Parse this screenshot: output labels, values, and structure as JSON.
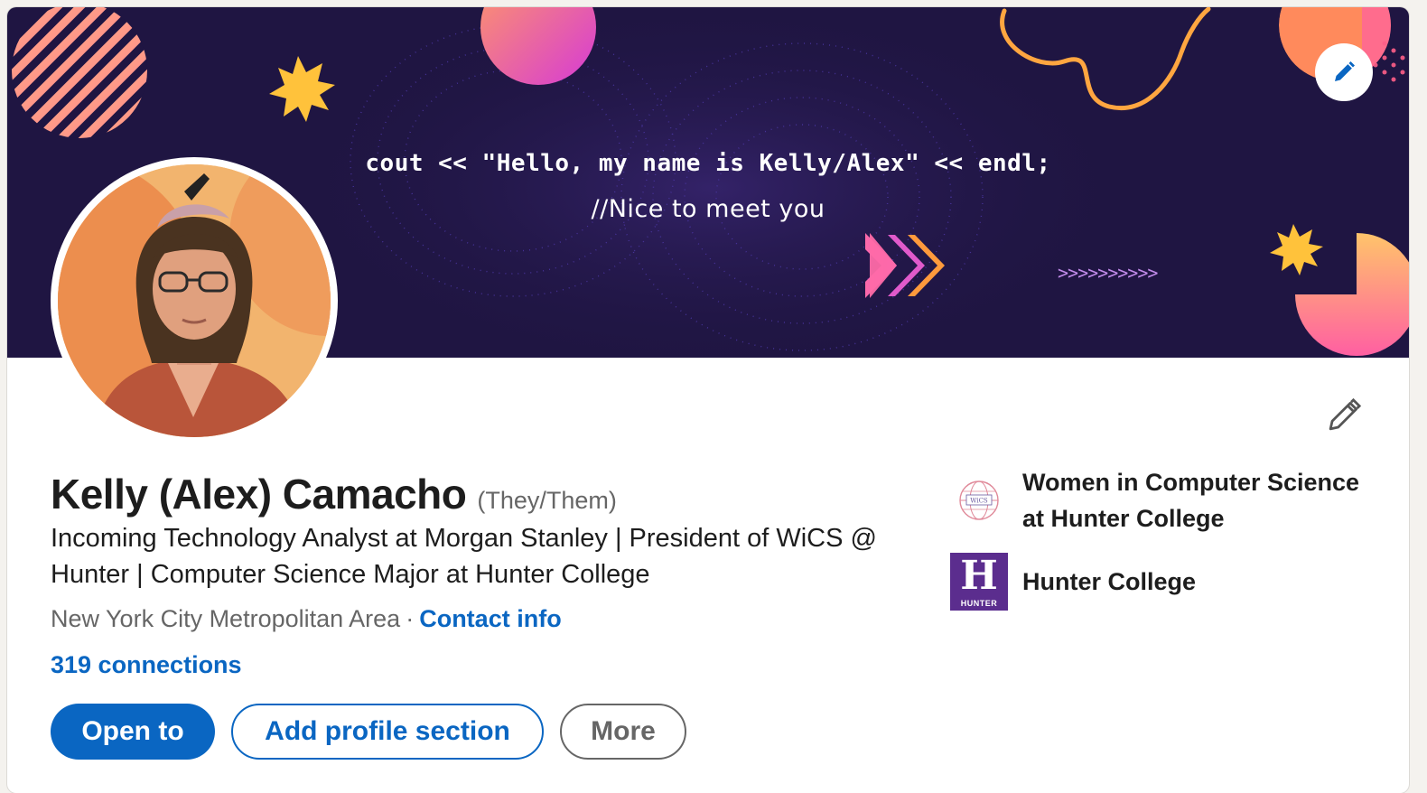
{
  "banner": {
    "code_line": "cout << \"Hello, my name is Kelly/Alex\" << endl;",
    "comment_line": "//Nice to meet you",
    "arrows_text": ">>>>>>>>>>",
    "edit_icon": "pencil-icon"
  },
  "profile": {
    "name": "Kelly (Alex) Camacho",
    "pronouns": "(They/Them)",
    "headline": "Incoming Technology Analyst at Morgan Stanley | President of WiCS @ Hunter | Computer Science Major at Hunter College",
    "location": "New York City Metropolitan Area",
    "separator": "·",
    "contact_label": "Contact info",
    "connections": "319 connections",
    "edit_icon": "pencil-icon"
  },
  "actions": {
    "open_to": "Open to",
    "add_section": "Add profile section",
    "more": "More"
  },
  "orgs": [
    {
      "name": "Women in Computer Science at Hunter College",
      "logo": "wics-logo"
    },
    {
      "name": "Hunter College",
      "logo": "hunter-logo",
      "logo_letter": "H",
      "logo_word": "HUNTER"
    }
  ],
  "colors": {
    "accent": "#0a66c2",
    "banner_bg": "#1f1542",
    "hunter_purple": "#5b2d8e",
    "text_primary": "#1d1d1d",
    "text_secondary": "#666666"
  }
}
